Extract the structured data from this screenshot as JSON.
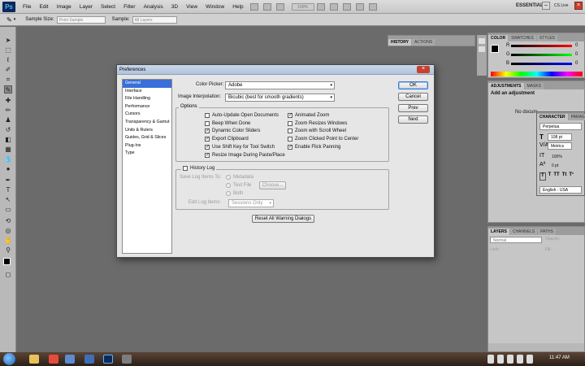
{
  "menubar": {
    "logo": "Ps",
    "items": [
      "File",
      "Edit",
      "Image",
      "Layer",
      "Select",
      "Filter",
      "Analysis",
      "3D",
      "View",
      "Window",
      "Help"
    ],
    "zoom": "100%",
    "workspace": "ESSENTIALS",
    "cs_live": "CS Live"
  },
  "optbar": {
    "sample_size_label": "Sample Size:",
    "sample_size_value": "Point Sample",
    "sample_label": "Sample:",
    "sample_value": "All Layers"
  },
  "panels": {
    "history_tabs": [
      "HISTORY",
      "ACTIONS"
    ],
    "color_tabs": [
      "COLOR",
      "SWATCHES",
      "STYLES"
    ],
    "color_channels": [
      "R",
      "G",
      "B"
    ],
    "color_values": [
      "0",
      "0",
      "0"
    ],
    "adjust_tabs": [
      "ADJUSTMENTS",
      "MASKS"
    ],
    "adjust_title": "Add an adjustment",
    "adjust_text": "No docum",
    "char_tabs": [
      "CHARACTER",
      "PARAGR"
    ],
    "font_name": "Perpetua",
    "font_size": "108 pt",
    "kerning": "Metrics",
    "scale": "100%",
    "baseline": "0 pt",
    "language": "English - USA",
    "layers_tabs": [
      "LAYERS",
      "CHANNELS",
      "PATHS"
    ],
    "blend_mode": "Normal",
    "opacity_label": "Opacity:",
    "lock_label": "Lock:",
    "fill_label": "Fill:"
  },
  "dialog": {
    "title": "Preferences",
    "nav": [
      "General",
      "Interface",
      "File Handling",
      "Performance",
      "Cursors",
      "Transparency & Gamut",
      "Units & Rulers",
      "Guides, Grid & Slices",
      "Plug-Ins",
      "Type"
    ],
    "color_picker_label": "Color Picker:",
    "color_picker_value": "Adobe",
    "interp_label": "Image Interpolation:",
    "interp_value": "Bicubic (best for smooth gradients)",
    "options_legend": "Options",
    "options_left": [
      {
        "label": "Auto-Update Open Documents",
        "checked": false
      },
      {
        "label": "Beep When Done",
        "checked": false
      },
      {
        "label": "Dynamic Color Sliders",
        "checked": true
      },
      {
        "label": "Export Clipboard",
        "checked": true
      },
      {
        "label": "Use Shift Key for Tool Switch",
        "checked": true
      },
      {
        "label": "Resize Image During Paste/Place",
        "checked": true
      }
    ],
    "options_right": [
      {
        "label": "Animated Zoom",
        "checked": true
      },
      {
        "label": "Zoom Resizes Windows",
        "checked": false
      },
      {
        "label": "Zoom with Scroll Wheel",
        "checked": false
      },
      {
        "label": "Zoom Clicked Point to Center",
        "checked": false
      },
      {
        "label": "Enable Flick Panning",
        "checked": true
      }
    ],
    "history_log_label": "History Log",
    "save_log_label": "Save Log Items To:",
    "metadata_label": "Metadata",
    "textfile_label": "Text File",
    "choose_label": "Choose...",
    "both_label": "Both",
    "edit_log_label": "Edit Log Items:",
    "edit_log_value": "Sessions Only",
    "reset_label": "Reset All Warning Dialogs",
    "ok_label": "OK",
    "cancel_label": "Cancel",
    "prev_label": "Prev",
    "next_label": "Next"
  },
  "taskbar": {
    "clock": "11:47 AM"
  }
}
